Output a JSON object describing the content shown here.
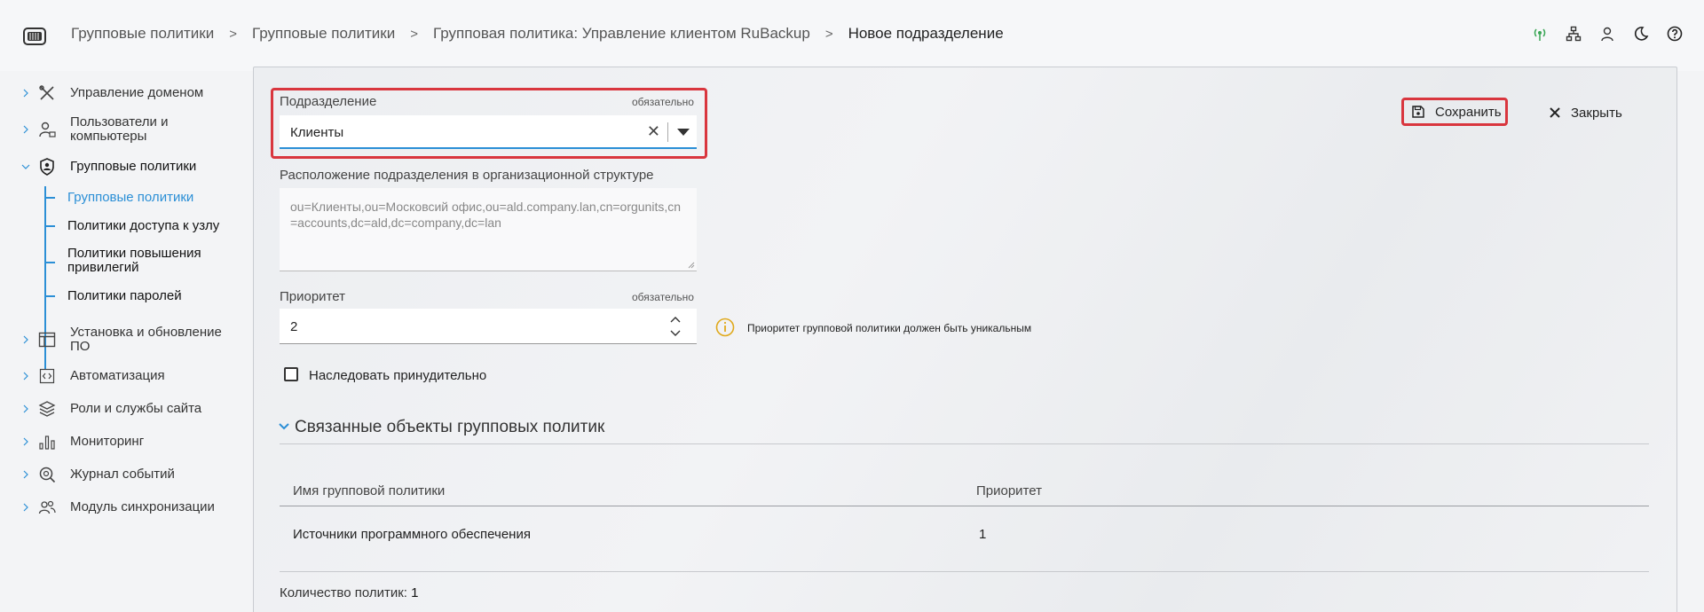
{
  "header": {
    "breadcrumbs": [
      "Групповые политики",
      "Групповые политики",
      "Групповая политика: Управление клиентом RuBackup",
      "Новое подразделение"
    ],
    "separator": ">"
  },
  "sidebar": {
    "items": [
      {
        "label": "Управление доменом",
        "icon": "tools-icon"
      },
      {
        "label": "Пользователи и компьютеры",
        "icon": "user-computer-icon"
      },
      {
        "label": "Групповые политики",
        "icon": "shield-user-icon"
      },
      {
        "label": "Установка и обновление ПО",
        "icon": "window-icon"
      },
      {
        "label": "Автоматизация",
        "icon": "code-icon"
      },
      {
        "label": "Роли и службы сайта",
        "icon": "layers-icon"
      },
      {
        "label": "Мониторинг",
        "icon": "bar-chart-icon"
      },
      {
        "label": "Журнал событий",
        "icon": "search-log-icon"
      },
      {
        "label": "Модуль синхронизации",
        "icon": "users-icon"
      }
    ],
    "subitems": [
      {
        "label": "Групповые политики",
        "active": true
      },
      {
        "label": "Политики доступа к узлу",
        "active": false
      },
      {
        "label": "Политики повышения привилегий",
        "active": false
      },
      {
        "label": "Политики паролей",
        "active": false
      }
    ]
  },
  "form": {
    "unit": {
      "label": "Подразделение",
      "required": "обязательно",
      "value": "Клиенты"
    },
    "location": {
      "label": "Расположение подразделения в организационной структуре",
      "value": "ou=Клиенты,ou=Московсий офис,ou=ald.company.lan,cn=orgunits,cn=accounts,dc=ald,dc=company,dc=lan"
    },
    "priority": {
      "label": "Приоритет",
      "required": "обязательно",
      "value": "2",
      "hint": "Приоритет групповой политики должен быть уникальным"
    },
    "inherit": {
      "label": "Наследовать принудительно",
      "checked": false
    }
  },
  "actions": {
    "save": "Сохранить",
    "close": "Закрыть"
  },
  "linked": {
    "title": "Связанные объекты групповых политик",
    "columns": [
      "Имя групповой политики",
      "Приоритет"
    ],
    "rows": [
      {
        "name": "Источники программного обеспечения",
        "priority": "1"
      }
    ],
    "count_label": "Количество политик:",
    "count": "1"
  },
  "colors": {
    "accent": "#2b8fd6",
    "highlight": "#d9363e",
    "info": "#e0a91b",
    "status_green": "#3aa655"
  }
}
